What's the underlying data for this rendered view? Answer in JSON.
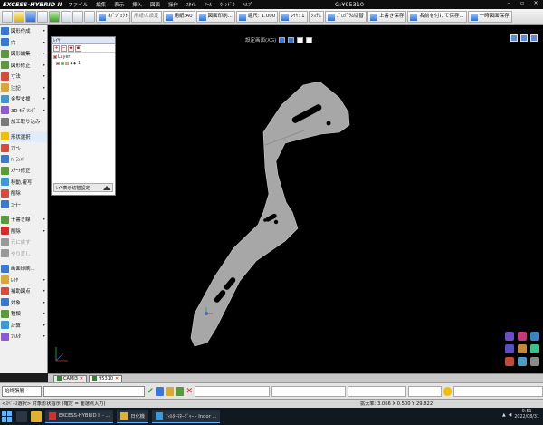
{
  "titlebar": {
    "app_name": "EXCESS-HYBRID II",
    "menu": [
      "ファイル",
      "編集",
      "表示",
      "挿入",
      "図面",
      "操作",
      "ｽﾀｲﾙ",
      "ﾂｰﾙ",
      "ｳｨﾝﾄﾞｳ",
      "ﾍﾙﾌﾟ"
    ],
    "document": "G:¥95310"
  },
  "toolbar": {
    "buttons": [
      {
        "label": "ｵﾌﾞｼﾞｪｸﾄ",
        "enabled": true
      },
      {
        "label": "用紙の設定",
        "enabled": false
      },
      {
        "label": "用紙:A0",
        "enabled": true
      },
      {
        "label": "図面印刷...",
        "enabled": true
      },
      {
        "label": "縮尺: 1.000",
        "enabled": true
      },
      {
        "label": "ﾚｲﾔ: 1",
        "enabled": true
      },
      {
        "label": "ｼｽﾃﾑ",
        "enabled": true
      },
      {
        "label": "ﾌﾟﾛｸﾞﾗﾑ切替",
        "enabled": true
      },
      {
        "label": "上書き保存",
        "enabled": true
      },
      {
        "label": "名前を付けて保存...",
        "enabled": true
      },
      {
        "label": "一時図面保存",
        "enabled": true
      }
    ]
  },
  "left_panel": {
    "items": [
      {
        "label": "図形作成",
        "icon": "draw-icon",
        "color": "#3a78d8",
        "arrow": true
      },
      {
        "label": "穴",
        "icon": "hole-icon",
        "color": "#3a78d8",
        "arrow": true
      },
      {
        "label": "図形編集",
        "icon": "edit-shape-icon",
        "color": "#5a9a3a",
        "arrow": true
      },
      {
        "label": "図形修正",
        "icon": "modify-shape-icon",
        "color": "#5a9a3a",
        "arrow": true
      },
      {
        "label": "寸法",
        "icon": "dimension-icon",
        "color": "#d84a3a",
        "arrow": true
      },
      {
        "label": "注記",
        "icon": "note-icon",
        "color": "#d8a83a",
        "arrow": true
      },
      {
        "label": "金型支援",
        "icon": "mold-icon",
        "color": "#3a9ad8",
        "arrow": true
      },
      {
        "label": "3D ﾓﾃﾞﾘﾝｸﾞ",
        "icon": "3d-modeling-icon",
        "color": "#8a5ad8",
        "arrow": true
      },
      {
        "label": "加工取り込み",
        "icon": "import-icon",
        "color": "#7a7a7a",
        "arrow": false
      },
      {
        "label": "形状選択",
        "icon": "select-shape-icon",
        "color": "#f0c000",
        "arrow": false,
        "highlight": true
      },
      {
        "label": "ﾌﾘｰﾚ",
        "icon": "free-icon",
        "color": "#d84a3a",
        "arrow": false
      },
      {
        "label": "ﾊﾟﾗﾝﾊﾟ",
        "icon": "parameter-icon",
        "color": "#3a78d8",
        "arrow": false
      },
      {
        "label": "ｽﾃｰﾄ修正",
        "icon": "state-edit-icon",
        "color": "#5a9a3a",
        "arrow": false
      },
      {
        "label": "移動,複写",
        "icon": "move-copy-icon",
        "color": "#3a9ad8",
        "arrow": false
      },
      {
        "label": "削除",
        "icon": "delete-icon",
        "color": "#d84a3a",
        "arrow": false
      },
      {
        "label": "ｺｰﾅｰ",
        "icon": "corner-icon",
        "color": "#3a78d8",
        "arrow": false
      },
      {
        "label": "干書き線",
        "icon": "line-icon",
        "color": "#5a9a3a",
        "arrow": true
      },
      {
        "label": "削除",
        "icon": "erase-icon",
        "color": "#d82a2a",
        "arrow": true
      },
      {
        "label": "元に戻す",
        "icon": "undo-icon",
        "color": "#999999",
        "arrow": false,
        "dim": true
      },
      {
        "label": "やり直し",
        "icon": "redo-icon",
        "color": "#999999",
        "arrow": false,
        "dim": true
      },
      {
        "label": "画面印刷...",
        "icon": "print-icon",
        "color": "#3a78d8",
        "arrow": false
      },
      {
        "label": "ﾚｲﾔ",
        "icon": "layer-icon",
        "color": "#d8a83a",
        "arrow": true
      },
      {
        "label": "補助図点",
        "icon": "aux-point-icon",
        "color": "#d84a3a",
        "arrow": true
      },
      {
        "label": "対象",
        "icon": "target-icon",
        "color": "#3a78d8",
        "arrow": true
      },
      {
        "label": "種類",
        "icon": "type-icon",
        "color": "#5a9a3a",
        "arrow": true
      },
      {
        "label": "計算",
        "icon": "calc-icon",
        "color": "#3a9ad8",
        "arrow": true
      },
      {
        "label": "ﾌｨﾙﾀ",
        "icon": "filter-icon",
        "color": "#8a5ad8",
        "arrow": true
      }
    ]
  },
  "viewport": {
    "top_label": "設定画面(XG)"
  },
  "layer_window": {
    "title": "ﾚｲﾔ",
    "tree": [
      "Layer",
      "◆◆ 1"
    ],
    "footer_label": "ﾚｲﾔ表示切替設定"
  },
  "tabs": [
    {
      "label": "CAMI3",
      "active": false
    },
    {
      "label": "95310",
      "active": true
    }
  ],
  "command_bar": {
    "command": "始終張層"
  },
  "status": {
    "left": "<ｽﾍﾟｰｽ選択> 対象形状指示 (確定 = 面選点入力)",
    "scale": "拡大率: 3.066  X 0.500  Y 29.822"
  },
  "taskbar": {
    "tasks": [
      "EXCESS-HYBRID II - ...",
      "日化機",
      "ﾌｨﾙﾀｰﾏﾈｰｼﾞｬｰ - Indor ..."
    ],
    "time": "9:51",
    "date": "2022/08/31"
  },
  "colors": {
    "viewport_bg": "#000000",
    "part_fill": "#a7a7a7",
    "accent": "#3a78d8"
  }
}
